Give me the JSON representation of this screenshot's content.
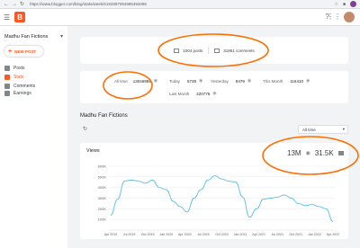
{
  "browser": {
    "url": "https://www.blogger.com/blog/stats/week/6192897094985392095",
    "nav_icons": [
      "back-icon",
      "forward-icon",
      "reload-icon"
    ]
  },
  "app": {
    "logo_letter": "B",
    "help_icon": "help-icon",
    "apps_icon": "apps-icon"
  },
  "sidebar": {
    "blog_name": "Madhu Fan Fictions",
    "new_post_label": "NEW POST",
    "items": [
      {
        "label": "Posts",
        "icon": "posts-icon"
      },
      {
        "label": "Stats",
        "icon": "stats-icon"
      },
      {
        "label": "Comments",
        "icon": "comments-icon"
      },
      {
        "label": "Earnings",
        "icon": "earnings-icon"
      }
    ]
  },
  "summary": {
    "posts": "1004 posts",
    "comments": "31951 comments"
  },
  "overview": {
    "all_time_label": "All time",
    "all_time_value": "13046959",
    "today_label": "Today",
    "today_value": "5739",
    "yesterday_label": "Yesterday",
    "yesterday_value": "8479",
    "this_month_label": "This Month",
    "this_month_value": "116410",
    "last_month_label": "Last Month",
    "last_month_value": "220775"
  },
  "section": {
    "title": "Madhu Fan Fictions",
    "range_selector": "All time"
  },
  "chart_card": {
    "title": "Views",
    "total_views": "13M",
    "total_comments": "31.5K"
  },
  "chart_data": {
    "type": "area",
    "title": "Views",
    "x_tick_labels": [
      "Apr 2019",
      "Jul 2019",
      "Oct 2019",
      "Jan 2020",
      "Apr 2020",
      "Jul 2020",
      "Oct 2020",
      "Jan 2021",
      "Apr 2021",
      "Jul 2021",
      "Oct 2021",
      "Jan 2022",
      "Apr 2022"
    ],
    "y_tick_labels": [
      "100K",
      "200K",
      "300K",
      "400K",
      "500K",
      "600K"
    ],
    "ylim": [
      0,
      600000
    ],
    "series": [
      {
        "values": [
          140000,
          290000,
          460000,
          470000,
          460000,
          440000,
          470000,
          400000,
          380000,
          270000,
          220000,
          170000,
          300000,
          380000,
          470000,
          510000,
          480000,
          460000,
          450000,
          310000,
          120000,
          200000,
          290000,
          300000,
          310000,
          330000,
          300000,
          250000,
          230000,
          240000,
          220000,
          200000,
          80000
        ]
      }
    ],
    "color": "#5bc0de",
    "grid": true
  },
  "colors": {
    "accent": "#ff5722",
    "annotation": "#ff6d00"
  }
}
